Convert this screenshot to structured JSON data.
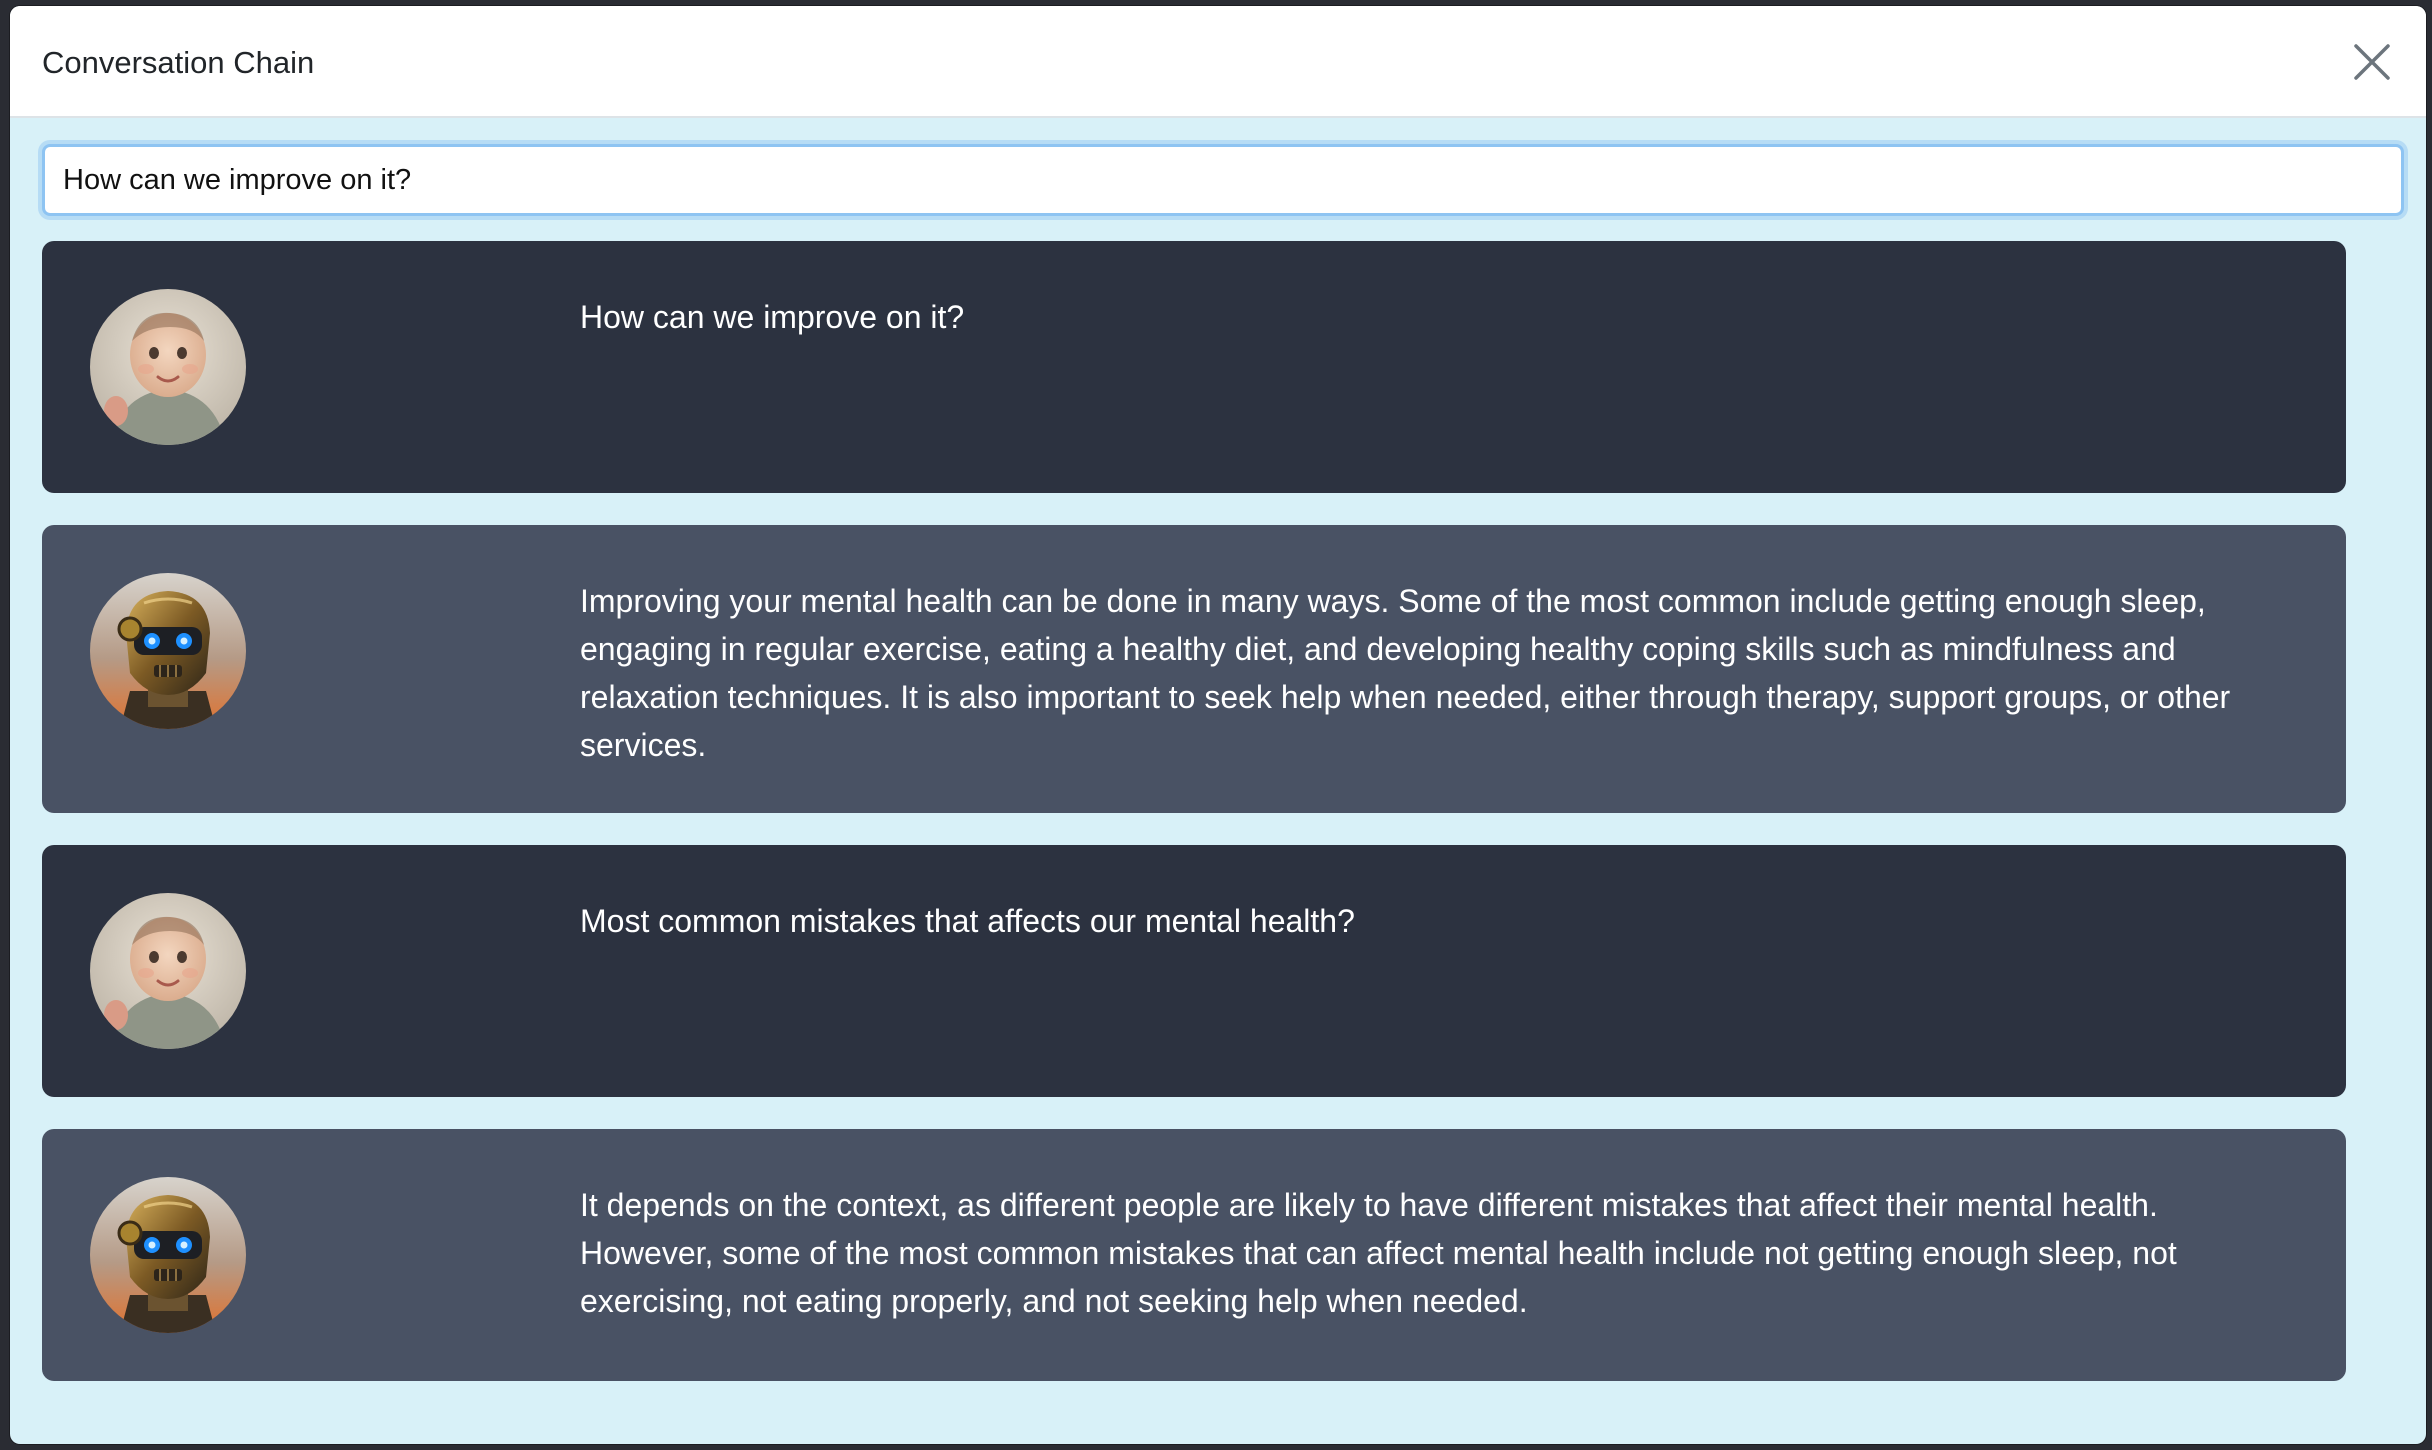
{
  "modal": {
    "title": "Conversation Chain",
    "close_icon": "close-icon"
  },
  "prompt": {
    "value": "How can we improve on it?"
  },
  "messages": [
    {
      "role": "user",
      "avatar": "baby-avatar",
      "text": "How can we improve on it?"
    },
    {
      "role": "bot",
      "avatar": "robot-avatar",
      "text": "Improving your mental health can be done in many ways. Some of the most common include getting enough sleep, engaging in regular exercise, eating a healthy diet, and developing healthy coping skills such as mindfulness and relaxation techniques. It is also important to seek help when needed, either through therapy, support groups, or other services."
    },
    {
      "role": "user",
      "avatar": "baby-avatar",
      "text": "Most common mistakes that affects our mental health?"
    },
    {
      "role": "bot",
      "avatar": "robot-avatar",
      "text": "It depends on the context, as different people are likely to have different mistakes that affect their mental health. However, some of the most common mistakes that can affect mental health include not getting enough sleep, not exercising, not eating properly, and not seeking help when needed."
    }
  ],
  "colors": {
    "modal_background": "#d8f1f8",
    "user_message_background": "#2c3240",
    "bot_message_background": "#495264",
    "input_focus_border": "#8ec4f2"
  }
}
